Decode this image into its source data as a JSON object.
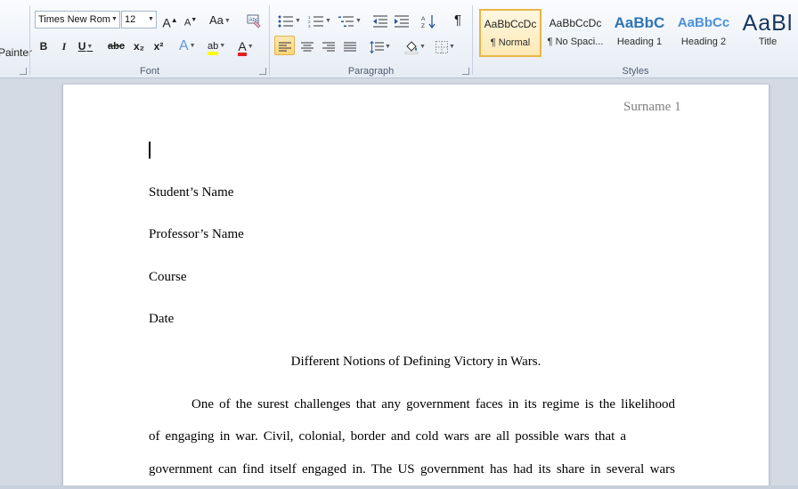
{
  "ribbon": {
    "clipboard": {
      "format_painter_label": "Painter"
    },
    "font": {
      "label": "Font",
      "font_name": "Times New Rom",
      "font_size": "12",
      "grow_font": "A",
      "shrink_font": "A",
      "change_case": "Aa",
      "bold": "B",
      "italic": "I",
      "underline": "U",
      "strikethrough": "abc",
      "subscript": "x₂",
      "superscript": "x²",
      "text_effects": "A",
      "highlight": "ab",
      "font_color": "A"
    },
    "paragraph": {
      "label": "Paragraph",
      "show_marks": "¶"
    },
    "styles": {
      "label": "Styles",
      "items": [
        {
          "sample": "AaBbCcDc",
          "name": "¶ Normal",
          "color": "#000000"
        },
        {
          "sample": "AaBbCcDc",
          "name": "¶ No Spaci...",
          "color": "#000000"
        },
        {
          "sample": "AaBbC",
          "name": "Heading 1",
          "color": "#2e74b5"
        },
        {
          "sample": "AaBbCc",
          "name": "Heading 2",
          "color": "#4a90d9"
        },
        {
          "sample": "AaBl",
          "name": "Title",
          "color": "#17365d"
        }
      ]
    }
  },
  "document": {
    "header": "Surname 1",
    "student_name": "Student’s Name",
    "professor_name": "Professor’s Name",
    "course": "Course",
    "date": "Date",
    "title": "Different Notions of Defining Victory in Wars.",
    "body_lines": [
      "One of the surest challenges that any government faces in its regime is the likelihood",
      "of engaging in war. Civil, colonial, border and cold wars are all possible  wars that a",
      "government can find itself engaged in. The US government has had its share in several wars"
    ]
  },
  "colors": {
    "accent_selected": "#e8b546",
    "ribbon_bg": "#e6ecf4",
    "workspace_bg": "#d3dae4"
  }
}
